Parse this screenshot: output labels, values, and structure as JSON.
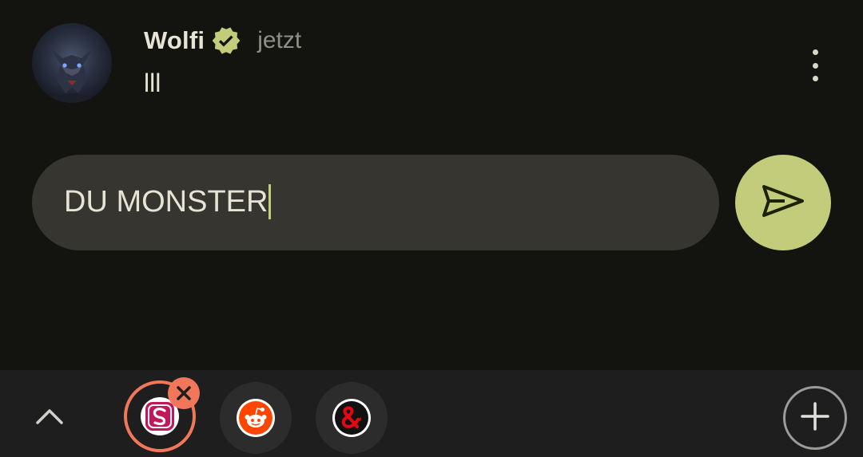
{
  "notification": {
    "sender": "Wolfi",
    "verified_icon": "verified-badge-icon",
    "time": "jetzt",
    "message": "lll",
    "more_icon": "more-vert-icon",
    "avatar_icon": "wolf-avatar"
  },
  "reply": {
    "text": "DU MONSTER",
    "send_icon": "send-icon"
  },
  "bubble_bar": {
    "collapse_icon": "chevron-up-icon",
    "bubbles": [
      {
        "app": "Shopping app",
        "icon": "s-logo-icon",
        "selected": true
      },
      {
        "app": "Reddit",
        "icon": "reddit-icon",
        "selected": false
      },
      {
        "app": "D&D",
        "icon": "ampersand-dragon-icon",
        "selected": false
      }
    ],
    "dismiss_icon": "close-icon",
    "add_icon": "plus-icon"
  },
  "colors": {
    "background": "#131310",
    "accent": "#c2cc7a",
    "reply_field": "#36352f",
    "bubble_bar": "#1e1e1f",
    "dismiss": "#f0775a"
  }
}
